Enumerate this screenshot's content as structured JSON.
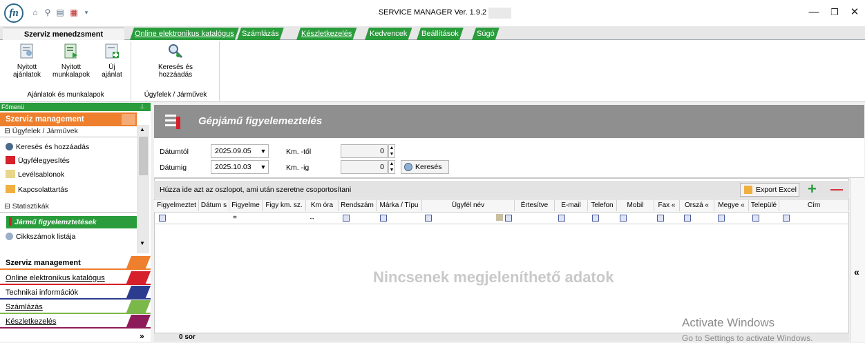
{
  "window": {
    "title": "SERVICE MANAGER Ver. 1.9.2",
    "min_label": "—",
    "max_label": "❐",
    "close_label": "✕"
  },
  "quick_access": [
    "⌂",
    "⚲",
    "▤",
    "▦",
    "▾"
  ],
  "ribbon": {
    "tabs": [
      {
        "label": "Szerviz menedzsment",
        "active": true
      },
      {
        "label": "Online elektronikus katalógus"
      },
      {
        "label": "Számlázás"
      },
      {
        "label": "Készletkezelés"
      },
      {
        "label": "Kedvencek"
      },
      {
        "label": "Beállítások"
      },
      {
        "label": "Súgó"
      }
    ],
    "groups": [
      {
        "label": "Ajánlatok és munkalapok",
        "buttons": [
          {
            "label1": "Nyitott",
            "label2": "ajánlatok"
          },
          {
            "label1": "Nyitott",
            "label2": "munkalapok"
          },
          {
            "label1": "Új",
            "label2": "ajánlat"
          }
        ]
      },
      {
        "label": "Ügyfelek / Járművek",
        "buttons": [
          {
            "label1": "Keresés és",
            "label2": "hozzáadás"
          }
        ]
      }
    ]
  },
  "sidebar": {
    "header": "Főmenü",
    "pin": "⊥",
    "section_title": "Szerviz management",
    "groups": [
      {
        "title": "Ügyfelek / Járművek",
        "items": [
          "Keresés és hozzáadás",
          "Ügyfélegyesítés",
          "Levélsablonok",
          "Kapcsolattartás"
        ]
      },
      {
        "title": "Statisztikák",
        "items": [
          "Jármű figyelemztetések",
          "Cikkszámok listája"
        ]
      }
    ],
    "collapse_glyph": "⊟",
    "scroll_up": "▲",
    "scroll_down": "▼",
    "nav": [
      {
        "label": "Szerviz management",
        "color": "#ee7f2d",
        "bold": true
      },
      {
        "label": "Online elektronikus katalógus",
        "color": "#d6202a"
      },
      {
        "label": "Technikai információk",
        "color": "#2b3c8f"
      },
      {
        "label": "Számlázás",
        "color": "#7bb84a"
      },
      {
        "label": "Készletkezelés",
        "color": "#8d1b5a"
      }
    ],
    "more_glyph": "»"
  },
  "main": {
    "title": "Gépjámű figyelemeztelés",
    "filter": {
      "from_label": "Dátumtól",
      "to_label": "Dátumig",
      "from_value": "2025.09.05",
      "to_value": "2025.10.03",
      "km_from_label": "Km. -től",
      "km_to_label": "Km. -ig",
      "km_from_value": "0",
      "km_to_value": "0",
      "search_label": "Keresés"
    },
    "grid": {
      "group_hint": "Húzza ide azt az oszlopot, ami után szeretne csoportosítani",
      "export_label": "Export Excel",
      "add_glyph": "+",
      "remove_glyph": "—",
      "columns": [
        "Figyelmeztet",
        "Dátum s",
        "Figyelme",
        "Figy km. sz.",
        "Km óra",
        "Rendszám",
        "Márka / Típu",
        "Ügyfél név",
        "Értesítve",
        "E-mail",
        "Telefon",
        "Mobil",
        "Fax «",
        "Orszá «",
        "Megye «",
        "Települé",
        "Cím"
      ],
      "empty_message": "Nincsenek megjeleníthető adatok",
      "footer_count": "0 sor"
    },
    "rail_glyph": "«"
  },
  "watermark": {
    "line1": "Activate Windows",
    "line2": "Go to Settings to activate Windows."
  },
  "colors": {
    "accent_green": "#2a9c3c",
    "accent_orange": "#ee7f2d",
    "header_gray": "#8f8f8f"
  }
}
